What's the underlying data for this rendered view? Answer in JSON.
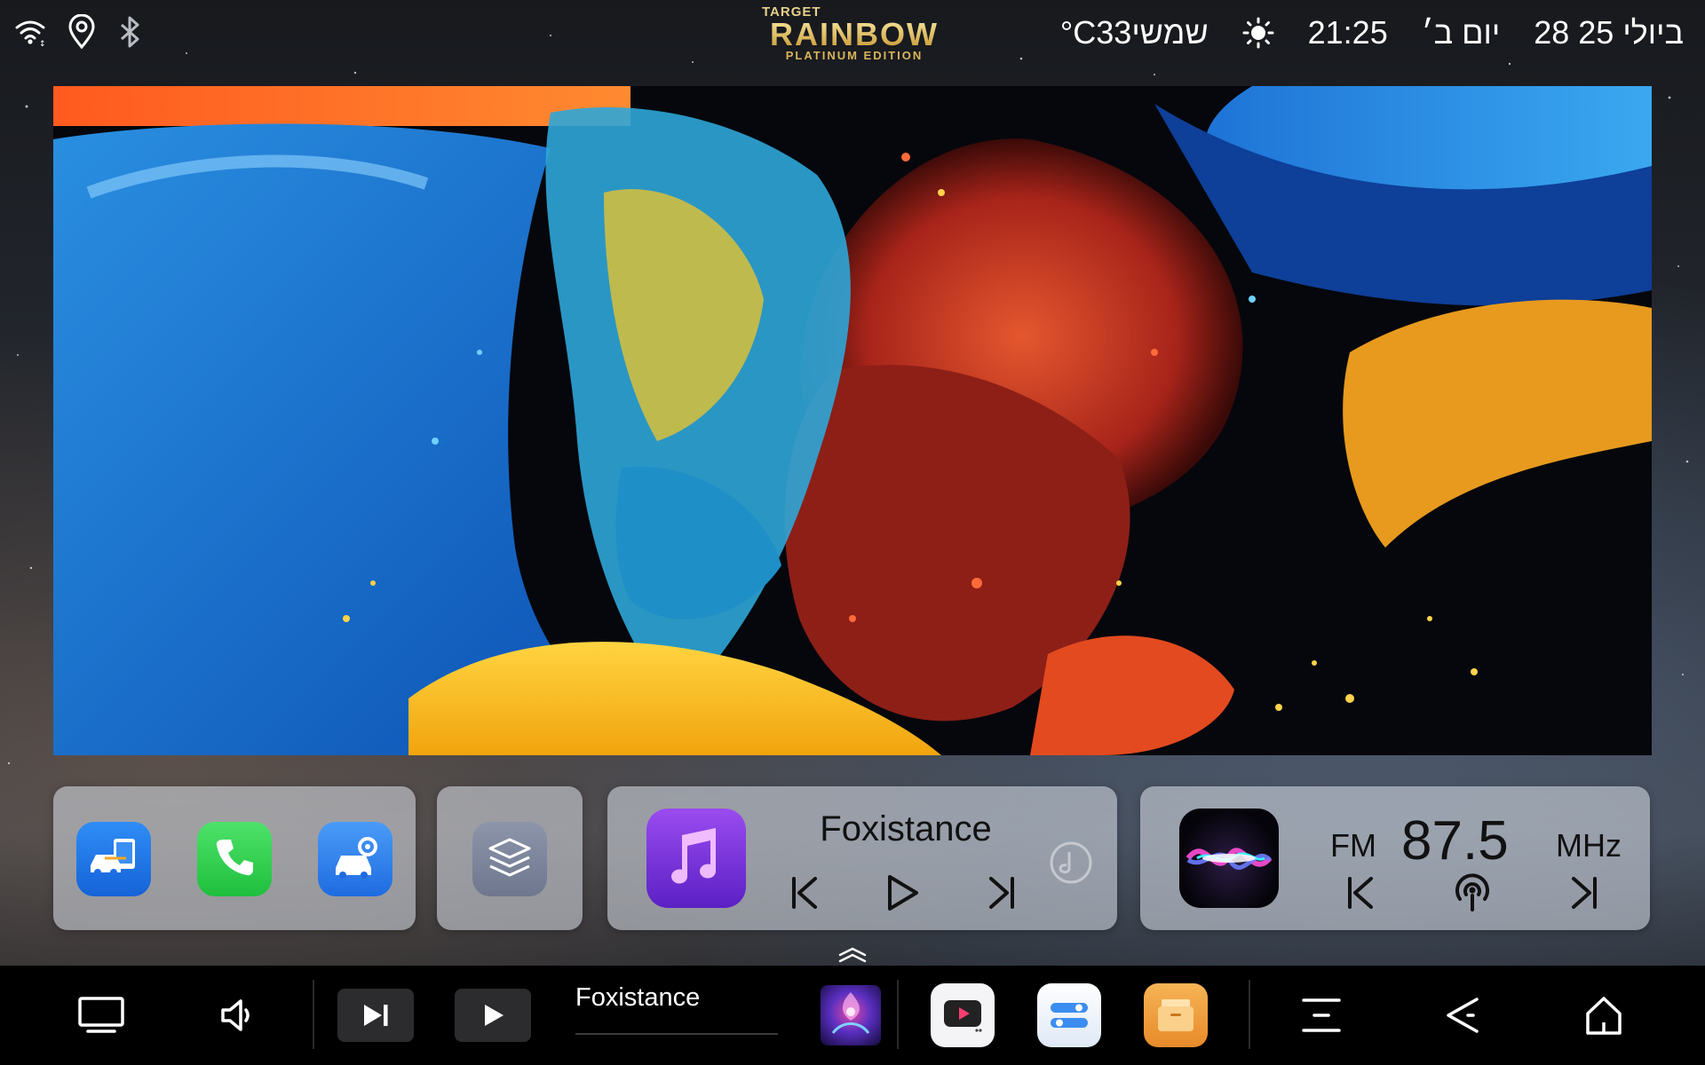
{
  "status_bar": {
    "icons": [
      "wifi-icon",
      "location-icon",
      "bluetooth-icon"
    ],
    "logo": {
      "line1": "TARGET",
      "line2": "RAINBOW",
      "line3": "PLATINUM EDITION"
    },
    "weather": "°C33שמשי",
    "weather_icon": "sun-icon",
    "time": "21:25",
    "weekday": "יום ב׳",
    "date": "28 ביולי 25"
  },
  "apps_widget": {
    "apps": [
      "car-link-icon",
      "phone-icon",
      "car-settings-icon"
    ]
  },
  "stack_widget": {
    "icon": "layers-icon"
  },
  "music_widget": {
    "title": "Foxistance",
    "controls": [
      "previous",
      "play",
      "next"
    ]
  },
  "radio_widget": {
    "band": "FM",
    "frequency": "87.5",
    "unit": "MHz",
    "controls": [
      "previous",
      "scan",
      "next"
    ]
  },
  "dock": {
    "now_playing": "Foxistance",
    "apps": [
      "video-player-icon",
      "toggles-icon",
      "file-manager-icon"
    ]
  },
  "colors": {
    "card_bg": "#dce1eb",
    "music_accent": "#7b35e0",
    "phone_green": "#2ad14c",
    "carlink_blue": "#1e6fe6",
    "files_orange": "#f0a040",
    "dock_bg": "#000000"
  }
}
